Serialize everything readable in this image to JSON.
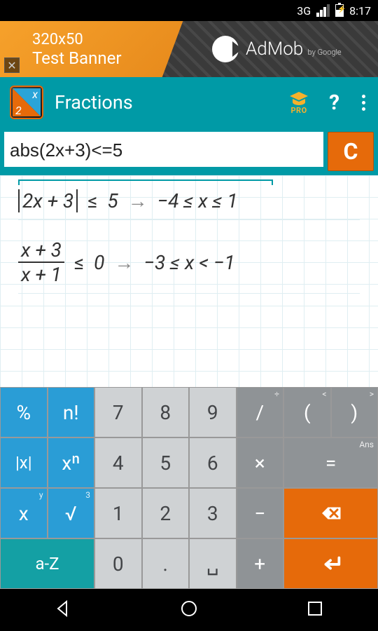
{
  "status": {
    "net": "3G",
    "time": "8:17"
  },
  "ad": {
    "line1": "320x50",
    "line2": "Test Banner",
    "brand": "AdMob",
    "by": "by Google"
  },
  "appbar": {
    "title": "Fractions",
    "pro": "PRO",
    "help": "?"
  },
  "input": {
    "value": "abs(2x+3)<=5",
    "clear": "C"
  },
  "results": [
    {
      "lhs_abs": "2x + 3",
      "rel": "≤",
      "rhs": "5",
      "ans": "−4 ≤ x ≤ 1"
    },
    {
      "frac_n": "x + 3",
      "frac_d": "x + 1",
      "rel": "≤",
      "rhs": "0",
      "ans": "−3 ≤ x < −1"
    }
  ],
  "keys": {
    "r1": [
      "%",
      "n!",
      "7",
      "8",
      "9",
      "/",
      "(",
      ")"
    ],
    "r1_sup": {
      "5": "÷",
      "6": "<",
      "7": ">"
    },
    "r2": [
      "|x|",
      "xⁿ",
      "4",
      "5",
      "6",
      "×",
      "="
    ],
    "r2_sup": {
      "6": "Ans"
    },
    "r3": [
      "x",
      "√",
      "1",
      "2",
      "3",
      "−",
      "⌫"
    ],
    "r3_sup": {
      "0": "y",
      "1": "3"
    },
    "r4": [
      "a-Z",
      "0",
      ".",
      "␣",
      "+",
      "↵"
    ]
  }
}
